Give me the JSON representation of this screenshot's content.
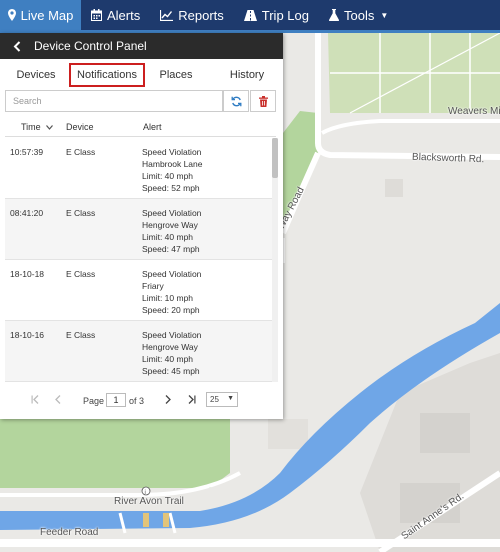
{
  "nav": {
    "items": [
      {
        "label": "Live Map",
        "icon": "map-marker-icon",
        "active": true
      },
      {
        "label": "Alerts",
        "icon": "calendar-icon",
        "active": false
      },
      {
        "label": "Reports",
        "icon": "line-chart-icon",
        "active": false
      },
      {
        "label": "Trip Log",
        "icon": "road-icon",
        "active": false
      },
      {
        "label": "Tools",
        "icon": "flask-icon",
        "active": false,
        "dropdown": true
      }
    ]
  },
  "panel": {
    "title": "Device Control Panel",
    "tabs": [
      "Devices",
      "Notifications",
      "Places",
      "History"
    ],
    "selected_tab": "Notifications",
    "search": {
      "placeholder": "Search",
      "value": ""
    },
    "columns": [
      "Time",
      "Device",
      "Alert"
    ],
    "rows": [
      {
        "time": "10:57:39",
        "device": "E Class",
        "alert": [
          "Speed Violation",
          "Hambrook Lane",
          "Limit: 40 mph",
          "Speed: 52 mph"
        ]
      },
      {
        "time": "08:41:20",
        "device": "E Class",
        "alert": [
          "Speed Violation",
          "Hengrove Way",
          "Limit: 40 mph",
          "Speed: 47 mph"
        ]
      },
      {
        "time": "18-10-18",
        "device": "E Class",
        "alert": [
          "Speed Violation",
          "Friary",
          "Limit: 10 mph",
          "Speed: 20 mph"
        ]
      },
      {
        "time": "18-10-16",
        "device": "E Class",
        "alert": [
          "Speed Violation",
          "Hengrove Way",
          "Limit: 40 mph",
          "Speed: 45 mph"
        ]
      }
    ],
    "pager": {
      "page_label": "Page",
      "page": "1",
      "of_label": "of 3",
      "per_page": "25"
    }
  },
  "map": {
    "labels": {
      "weavers": "Weavers Mill",
      "blacksworth": "Blacksworth Rd.",
      "way_road": "Way Road",
      "river_trail": "River Avon Trail",
      "feeder": "Feeder Road",
      "saint_annes": "Saint Anne's Rd."
    },
    "colors": {
      "land": "#eae9e6",
      "park": "#cfe0b8",
      "green": "#b3d59d",
      "water": "#6fa6e7",
      "road": "#ffffff"
    }
  },
  "colors": {
    "nav_bg": "#1e3a6d",
    "nav_active": "#3f7fc1",
    "highlight": "#cc1f1f",
    "header_bg": "#2b2b2b"
  }
}
